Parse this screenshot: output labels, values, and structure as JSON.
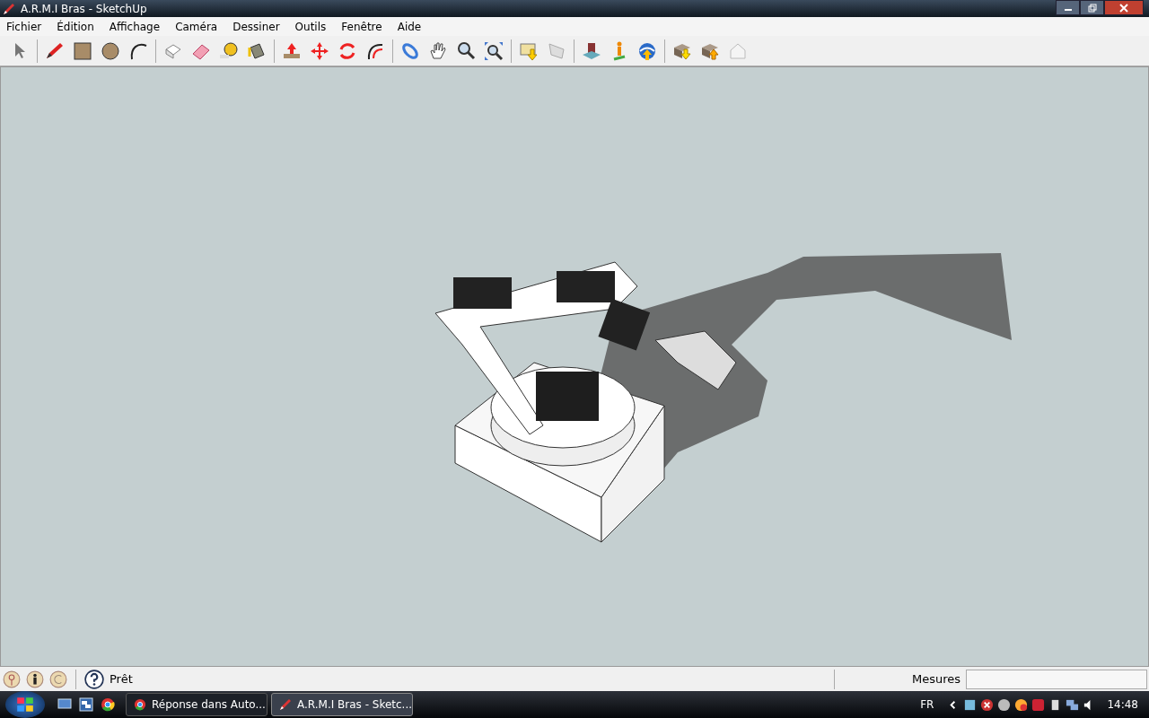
{
  "window": {
    "title": "A.R.M.I Bras - SketchUp"
  },
  "menu": [
    "Fichier",
    "Édition",
    "Affichage",
    "Caméra",
    "Dessiner",
    "Outils",
    "Fenêtre",
    "Aide"
  ],
  "status_bar": {
    "text": "Prêt",
    "measure_label": "Mesures"
  },
  "taskbar": {
    "tasks": [
      {
        "label": "Réponse dans Auto...",
        "selected": false,
        "kind": "browser"
      },
      {
        "label": "A.R.M.I Bras - Sketc...",
        "selected": true,
        "kind": "sketchup"
      }
    ],
    "language": "FR",
    "clock": "14:48"
  }
}
